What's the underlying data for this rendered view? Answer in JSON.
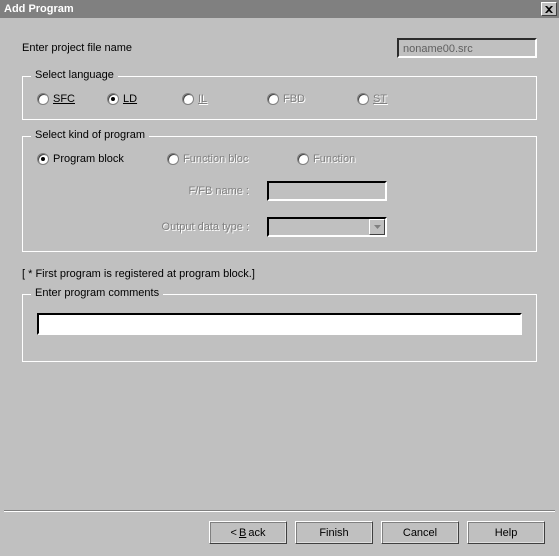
{
  "window": {
    "title": "Add Program"
  },
  "project": {
    "label": "Enter project file name",
    "filename": "noname00.src"
  },
  "language": {
    "legend": "Select language",
    "options": {
      "sfc": "SFC",
      "ld": "LD",
      "il": "IL",
      "fbd": "FBD",
      "st": "ST"
    },
    "selected": "ld"
  },
  "kind": {
    "legend": "Select kind of program",
    "options": {
      "program_block": "Program block",
      "function_bloc": "Function bloc",
      "function": "Function"
    },
    "selected": "program_block",
    "ffb_label": "F/FB name :",
    "output_label": "Output data type :",
    "ffb_value": "",
    "output_value": ""
  },
  "note": "[ * First program is registered at program block.]",
  "comments": {
    "legend": "Enter program comments",
    "value": ""
  },
  "buttons": {
    "back_prefix": "< ",
    "back_u": "B",
    "back_rest": "ack",
    "finish": "Finish",
    "cancel": "Cancel",
    "help": "Help"
  }
}
